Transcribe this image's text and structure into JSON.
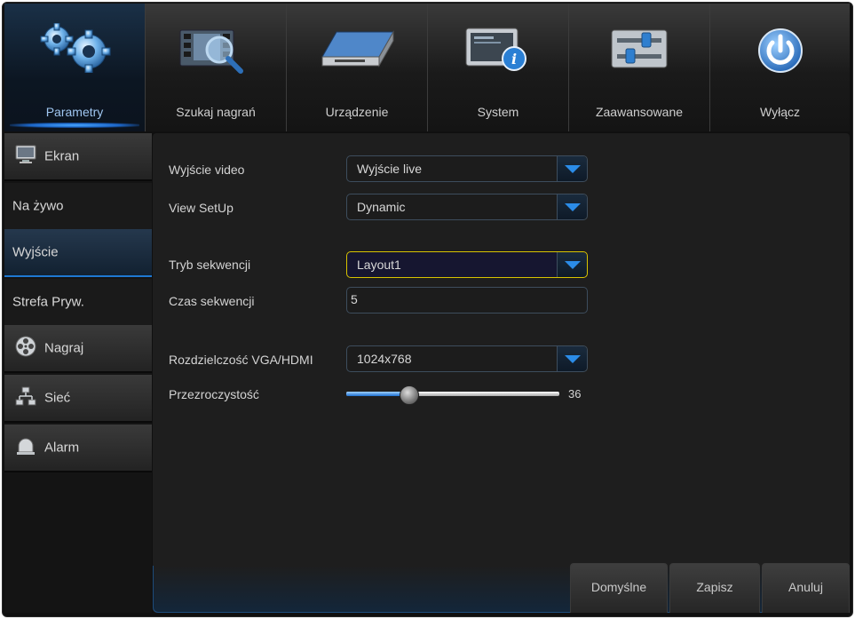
{
  "nav": {
    "items": [
      {
        "label": "Parametry",
        "icon": "gears-icon",
        "active": true
      },
      {
        "label": "Szukaj nagrań",
        "icon": "film-search-icon",
        "active": false
      },
      {
        "label": "Urządzenie",
        "icon": "hard-drive-icon",
        "active": false
      },
      {
        "label": "System",
        "icon": "system-info-icon",
        "active": false
      },
      {
        "label": "Zaawansowane",
        "icon": "sliders-icon",
        "active": false
      },
      {
        "label": "Wyłącz",
        "icon": "power-icon",
        "active": false
      }
    ]
  },
  "sidebar": {
    "items": [
      {
        "label": "Ekran",
        "icon": "monitor-icon",
        "type": "category"
      },
      {
        "label": "Na żywo",
        "type": "sub"
      },
      {
        "label": "Wyjście",
        "type": "sub",
        "active": true
      },
      {
        "label": "Strefa Pryw.",
        "type": "sub"
      },
      {
        "label": "Nagraj",
        "icon": "film-reel-icon",
        "type": "category"
      },
      {
        "label": "Sieć",
        "icon": "network-icon",
        "type": "category"
      },
      {
        "label": "Alarm",
        "icon": "alarm-icon",
        "type": "category"
      }
    ]
  },
  "form": {
    "video_output": {
      "label": "Wyjście video",
      "value": "Wyjście live"
    },
    "view_setup": {
      "label": "View SetUp",
      "value": "Dynamic"
    },
    "sequence_mode": {
      "label": "Tryb sekwencji",
      "value": "Layout1"
    },
    "sequence_time": {
      "label": "Czas sekwencji",
      "value": "5"
    },
    "resolution": {
      "label": "Rozdzielczość VGA/HDMI",
      "value": "1024x768"
    },
    "transparency": {
      "label": "Przezroczystość",
      "value": "36",
      "fraction": 0.29
    }
  },
  "buttons": {
    "default": "Domyślne",
    "save": "Zapisz",
    "cancel": "Anuluj"
  },
  "colors": {
    "accent": "#1e78d2",
    "focus": "#d8c400",
    "background": "#1e1e1e"
  }
}
